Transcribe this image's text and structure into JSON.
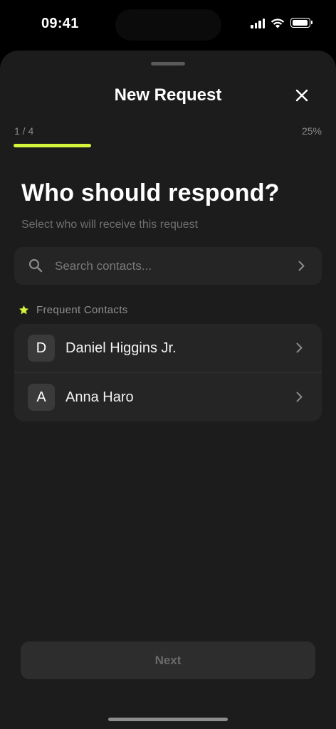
{
  "status_bar": {
    "time": "09:41",
    "icons": [
      "signal-icon",
      "wifi-icon",
      "battery-icon"
    ]
  },
  "sheet": {
    "title": "New Request",
    "close_icon": "close-icon"
  },
  "progress": {
    "step_label": "1 / 4",
    "percent_label": "25%",
    "fraction": 0.25,
    "accent_color": "#d4f53c"
  },
  "question": {
    "title": "Who should respond?",
    "subtitle": "Select who will receive this request"
  },
  "search": {
    "placeholder": "Search contacts..."
  },
  "frequent": {
    "label": "Frequent Contacts",
    "icon": "star-icon",
    "contacts": [
      {
        "initial": "D",
        "name": "Daniel Higgins Jr."
      },
      {
        "initial": "A",
        "name": "Anna Haro"
      }
    ]
  },
  "footer": {
    "next_label": "Next"
  }
}
